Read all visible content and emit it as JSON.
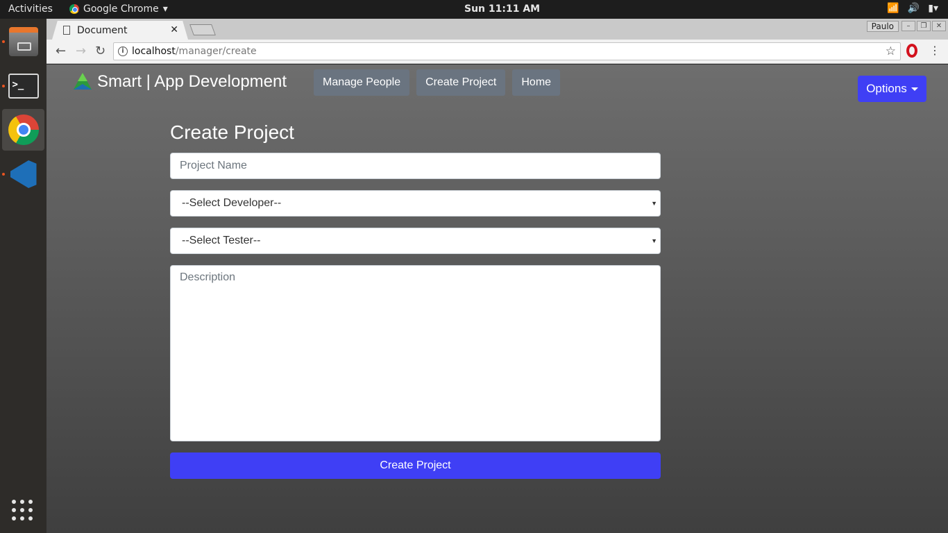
{
  "system": {
    "activities": "Activities",
    "app_menu": "Google Chrome",
    "clock": "Sun 11:11 AM"
  },
  "browser": {
    "tab_title": "Document",
    "profile": "Paulo",
    "url_host": "localhost",
    "url_path": "/manager/create"
  },
  "page": {
    "brand": "Smart | App Development",
    "nav": [
      "Manage People",
      "Create Project",
      "Home"
    ],
    "options_label": "Options",
    "form": {
      "title": "Create Project",
      "project_name_placeholder": "Project Name",
      "developer_select": "--Select Developer--",
      "tester_select": "--Select Tester--",
      "description_placeholder": "Description",
      "submit_label": "Create Project"
    }
  },
  "colors": {
    "accent": "#3f3ff5",
    "nav_button": "#6a7480"
  }
}
